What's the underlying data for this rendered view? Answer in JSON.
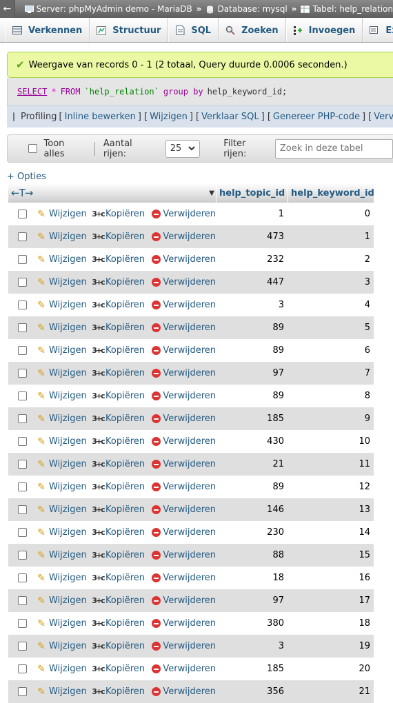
{
  "breadcrumb": {
    "back_icon": "arrow-left-icon",
    "items": [
      {
        "label": "Server: phpMyAdmin demo - MariaDB",
        "icon": "server-icon"
      },
      {
        "label": "Database: mysql",
        "icon": "database-icon"
      },
      {
        "label": "Tabel: help_relation",
        "icon": "table-icon"
      }
    ],
    "separator": "»"
  },
  "tabs": [
    {
      "label": "Verkennen",
      "icon": "browse-icon"
    },
    {
      "label": "Structuur",
      "icon": "structure-icon"
    },
    {
      "label": "SQL",
      "icon": "sql-icon"
    },
    {
      "label": "Zoeken",
      "icon": "search-icon"
    },
    {
      "label": "Invoegen",
      "icon": "insert-icon"
    },
    {
      "label": "Exporteren",
      "icon": "export-icon"
    }
  ],
  "message": {
    "text": "Weergave van records 0 - 1 (2 totaal, Query duurde 0.0006 seconden.)",
    "color": "#ebf8a4"
  },
  "sql": {
    "select": "SELECT",
    "star": "*",
    "from": "FROM",
    "table": "`help_relation`",
    "group": "group by",
    "rest": "help_keyword_id;"
  },
  "profiling": {
    "label": "Profiling",
    "links": [
      "Inline bewerken",
      "Wijzigen",
      "Verklaar SQL",
      "Genereer PHP-code",
      "Ververs"
    ]
  },
  "nav": {
    "show_all": "Toon alles",
    "rows_label": "Aantal rijen:",
    "rows_value": "25",
    "filter_label": "Filter rijen:",
    "filter_placeholder": "Zoek in deze tabel"
  },
  "options_link": "+ Opties",
  "table": {
    "columns": [
      "help_topic_id",
      "help_keyword_id"
    ],
    "actions": {
      "edit": "Wijzigen",
      "copy": "Kopiëren",
      "delete": "Verwijderen"
    },
    "rows": [
      [
        1,
        0
      ],
      [
        473,
        1
      ],
      [
        232,
        2
      ],
      [
        447,
        3
      ],
      [
        3,
        4
      ],
      [
        89,
        5
      ],
      [
        89,
        6
      ],
      [
        97,
        7
      ],
      [
        89,
        8
      ],
      [
        185,
        9
      ],
      [
        430,
        10
      ],
      [
        21,
        11
      ],
      [
        89,
        12
      ],
      [
        146,
        13
      ],
      [
        230,
        14
      ],
      [
        88,
        15
      ],
      [
        18,
        16
      ],
      [
        97,
        17
      ],
      [
        380,
        18
      ],
      [
        3,
        19
      ],
      [
        185,
        20
      ],
      [
        356,
        21
      ]
    ]
  },
  "colors": {
    "link": "#235a81",
    "row_alt": "#dfdfdf",
    "success_border": "#a2d246"
  }
}
